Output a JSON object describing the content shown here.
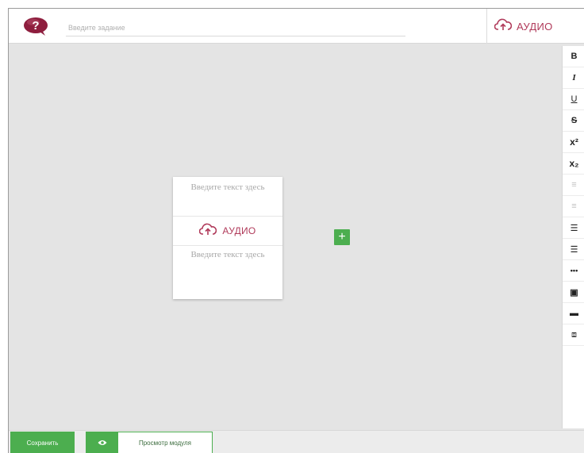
{
  "header": {
    "task_placeholder": "Введите задание",
    "audio_label": "АУДИО"
  },
  "toolbar": {
    "buttons": [
      {
        "name": "bold",
        "glyph": "B"
      },
      {
        "name": "italic",
        "glyph": "I"
      },
      {
        "name": "underline",
        "glyph": "U"
      },
      {
        "name": "strikethrough",
        "glyph": "S"
      },
      {
        "name": "superscript",
        "glyph": "x²"
      },
      {
        "name": "subscript",
        "glyph": "x₂"
      },
      {
        "name": "align",
        "glyph": "≡"
      },
      {
        "name": "align-center",
        "glyph": "≡"
      },
      {
        "name": "bulleted-list",
        "glyph": "☰"
      },
      {
        "name": "numbered-list",
        "glyph": "☰"
      },
      {
        "name": "more",
        "glyph": "•••"
      },
      {
        "name": "comment",
        "glyph": "▣"
      },
      {
        "name": "image",
        "glyph": "▬"
      },
      {
        "name": "crop",
        "glyph": "⧈"
      }
    ]
  },
  "card": {
    "text_placeholder_top": "Введите текст здесь",
    "audio_label": "АУДИО",
    "text_placeholder_bottom": "Введите текст здесь"
  },
  "add_button": {
    "label": "+"
  },
  "footer": {
    "save_label": "Сохранить",
    "preview_label": "Просмотр модуля"
  },
  "colors": {
    "accent_green": "#4cae4f",
    "audio_red": "#b03a5a",
    "help_icon": "#8e1e3e"
  }
}
